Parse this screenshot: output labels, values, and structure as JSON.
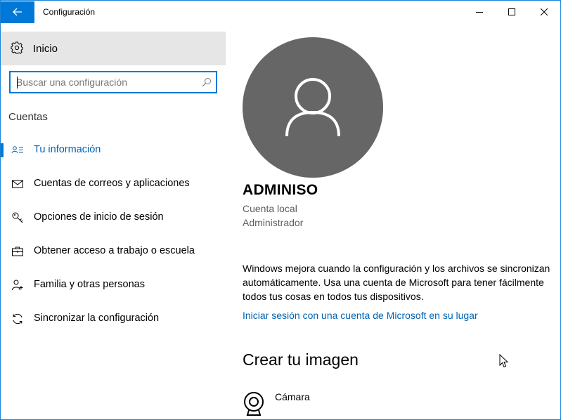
{
  "window": {
    "title": "Configuración",
    "accent_color": "#0078d7",
    "controls": [
      "minimize-icon",
      "maximize-icon",
      "close-icon"
    ]
  },
  "sidebar": {
    "home": {
      "label": "Inicio",
      "icon": "gear-icon"
    },
    "search": {
      "value": "",
      "placeholder": "Buscar una configuración",
      "icon": "search-icon"
    },
    "section_label": "Cuentas",
    "items": [
      {
        "label": "Tu información",
        "icon": "person-card-icon",
        "active": true
      },
      {
        "label": "Cuentas de correos y aplicaciones",
        "icon": "mail-icon",
        "active": false
      },
      {
        "label": "Opciones de inicio de sesión",
        "icon": "key-icon",
        "active": false
      },
      {
        "label": "Obtener acceso a trabajo o escuela",
        "icon": "briefcase-icon",
        "active": false
      },
      {
        "label": "Familia y otras personas",
        "icon": "add-person-icon",
        "active": false
      },
      {
        "label": "Sincronizar la configuración",
        "icon": "sync-icon",
        "active": false
      }
    ]
  },
  "main": {
    "user": {
      "name": "ADMINISO",
      "account_type": "Cuenta local",
      "role": "Administrador"
    },
    "info_text": "Windows mejora cuando la configuración y los archivos se sincronizan automáticamente. Usa una cuenta de Microsoft para tener fácilmente todos tus cosas en todos tus dispositivos.",
    "ms_link": "Iniciar sesión con una cuenta de Microsoft en su lugar",
    "create_image_title": "Crear tu imagen",
    "camera_label": "Cámara"
  },
  "colors": {
    "accent": "#0078d7",
    "link": "#0063b1",
    "avatar_bg": "#666666",
    "home_bg": "#e6e6e6",
    "secondary_text": "#5d5d5d"
  }
}
